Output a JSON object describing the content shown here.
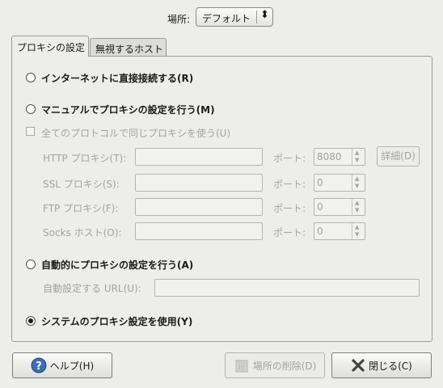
{
  "location": {
    "label": "場所:",
    "value": "デフォルト"
  },
  "tabs": [
    {
      "label": "プロキシの設定"
    },
    {
      "label": "無視するホスト"
    }
  ],
  "options": {
    "direct": "インターネットに直接接続する(R)",
    "manual": "マニュアルでプロキシの設定を行う(M)",
    "same_proxy": "全てのプロトコルで同じプロキシを使う(U)",
    "auto": "自動的にプロキシの設定を行う(A)",
    "system": "システムのプロキシ設定を使用(Y)"
  },
  "proxies": [
    {
      "label": "HTTP プロキシ(T):",
      "port_label": "ポート:",
      "port": "8080"
    },
    {
      "label": "SSL プロキシ(S):",
      "port_label": "ポート:",
      "port": "0"
    },
    {
      "label": "FTP プロキシ(F):",
      "port_label": "ポート:",
      "port": "0"
    },
    {
      "label": "Socks ホスト(O):",
      "port_label": "ポート:",
      "port": "0"
    }
  ],
  "details_button": "詳細(D)",
  "auto_url_label": "自動設定する URL(U):",
  "buttons": {
    "help": "ヘルプ(H)",
    "delete_location": "場所の削除(D)",
    "close": "閉じる(C)"
  },
  "selected_option": "system"
}
